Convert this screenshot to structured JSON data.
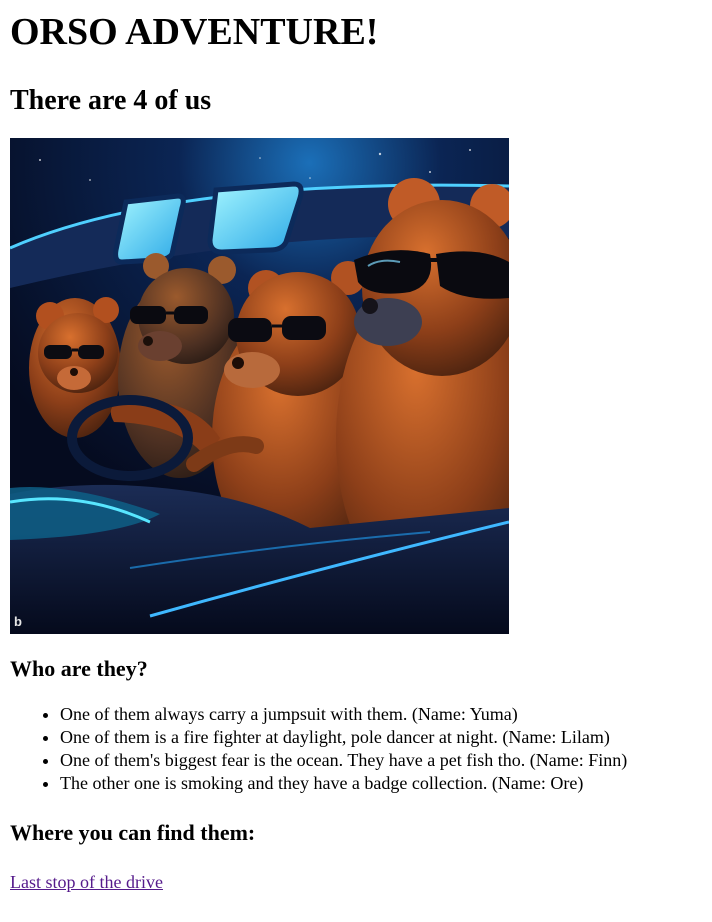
{
  "page": {
    "title": "ORSO ADVENTURE!",
    "subtitle": "There are 4 of us",
    "image": {
      "alt": "Four bears wearing sunglasses driving a car at night"
    },
    "who_heading": "Who are they?",
    "members": [
      "One of them always carry a jumpsuit with them. (Name: Yuma)",
      "One of them is a fire fighter at daylight, pole dancer at night. (Name: Lilam)",
      "One of them's biggest fear is the ocean. They have a pet fish tho. (Name: Finn)",
      "The other one is smoking and they have a badge collection. (Name: Ore)"
    ],
    "find_heading": "Where you can find them:",
    "link_text": "Last stop of the drive"
  },
  "colors": {
    "text": "#000000",
    "visited_link": "#551a8b",
    "night_sky": "#06102a",
    "neon_blue": "#37d9ff",
    "bear_brown": "#9a4a1d"
  }
}
